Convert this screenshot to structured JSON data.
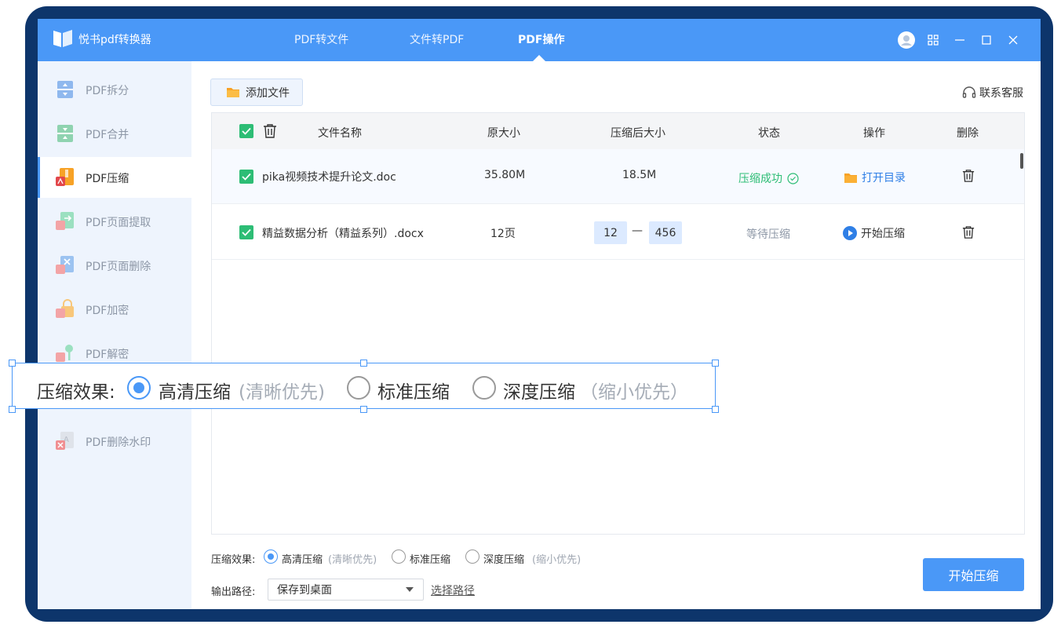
{
  "app": {
    "title": "悦书pdf转换器"
  },
  "nav": {
    "tabs": [
      "PDF转文件",
      "文件转PDF",
      "PDF操作"
    ],
    "active": "PDF操作"
  },
  "sidebar": {
    "items": [
      "PDF拆分",
      "PDF合并",
      "PDF压缩",
      "PDF页面提取",
      "PDF页面删除",
      "PDF加密",
      "PDF解密",
      "PDF删除水印"
    ],
    "active": "PDF压缩"
  },
  "toolbar": {
    "add_file": "添加文件",
    "service": "联系客服"
  },
  "table": {
    "headers": {
      "name": "文件名称",
      "orig": "原大小",
      "after": "压缩后大小",
      "status": "状态",
      "op": "操作",
      "del": "删除"
    },
    "rows": [
      {
        "name": "pika视频技术提升论文.doc",
        "orig": "35.80M",
        "after": "18.5M",
        "status": "压缩成功",
        "op": "打开目录"
      },
      {
        "name": "精益数据分析（精益系列）.docx",
        "orig": "12页",
        "page_from": "12",
        "dash": "—",
        "page_to": "456",
        "status": "等待压缩",
        "op": "开始压缩"
      }
    ]
  },
  "bottom": {
    "effect_label": "压缩效果:",
    "options": [
      {
        "label": "高清压缩",
        "hint": "(清晰优先)",
        "selected": true
      },
      {
        "label": "标准压缩",
        "hint": "",
        "selected": false
      },
      {
        "label": "深度压缩",
        "hint": "(缩小优先)",
        "selected": false
      }
    ],
    "output_label": "输出路径:",
    "output_value": "保存到桌面",
    "choose_path": "选择路径",
    "start": "开始压缩"
  },
  "zoom": {
    "label": "压缩效果:",
    "opt1": "高清压缩",
    "hint1": "(清晰优先)",
    "opt2": "标准压缩",
    "opt3": "深度压缩",
    "hint3": "（缩小优先）"
  },
  "colors": {
    "accent": "#4a98f7",
    "success": "#2dbd75",
    "frame": "#0d356b",
    "folder": "#f7a226"
  }
}
